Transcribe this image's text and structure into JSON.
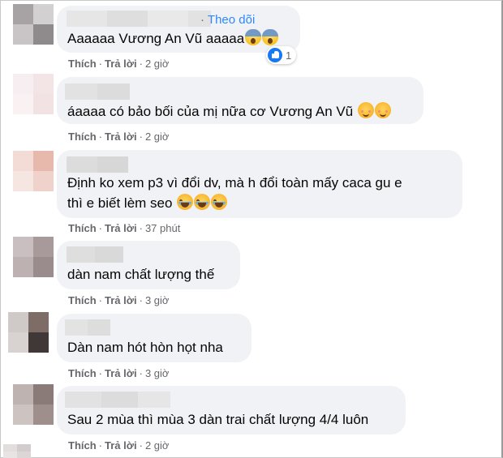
{
  "comments": [
    {
      "text": "Aaaaaa Vương An Vũ aaaaa",
      "follow_label": "Theo dõi",
      "follow_separator": "·",
      "emojis": [
        "scream-emoji",
        "scream-emoji"
      ],
      "reaction_count": "1",
      "like_label": "Thích",
      "reply_label": "Trả lời",
      "separator": "·",
      "time": "2 giờ"
    },
    {
      "text": "áaaaa có bảo bối của mị nữa cơ Vương An Vũ",
      "emojis": [
        "smiling-emoji",
        "smiling-emoji"
      ],
      "like_label": "Thích",
      "reply_label": "Trả lời",
      "separator": "·",
      "time": "2 giờ"
    },
    {
      "text_line1": "Định ko xem p3 vì đổi dv, mà h đổi toàn mấy caca gu e",
      "text_line2": "thì e biết lèm seo",
      "emojis": [
        "laughing-emoji",
        "laughing-emoji",
        "laughing-emoji"
      ],
      "like_label": "Thích",
      "reply_label": "Trả lời",
      "separator": "·",
      "time": "37 phút"
    },
    {
      "text": "dàn nam chất lượng thế",
      "like_label": "Thích",
      "reply_label": "Trả lời",
      "separator": "·",
      "time": "3 giờ"
    },
    {
      "text": "Dàn nam hót hòn họt nha",
      "like_label": "Thích",
      "reply_label": "Trả lời",
      "separator": "·",
      "time": "3 giờ"
    },
    {
      "text": "Sau 2 mùa thì mùa 3 dàn trai chất lượng 4/4 luôn",
      "like_label": "Thích",
      "reply_label": "Trả lời",
      "separator": "·",
      "time": "2 giờ"
    }
  ],
  "colors": {
    "bubble": "#f0f2f5",
    "text": "#050505",
    "meta": "#65676b",
    "follow": "#2d88ff",
    "like": "#1877f2"
  }
}
